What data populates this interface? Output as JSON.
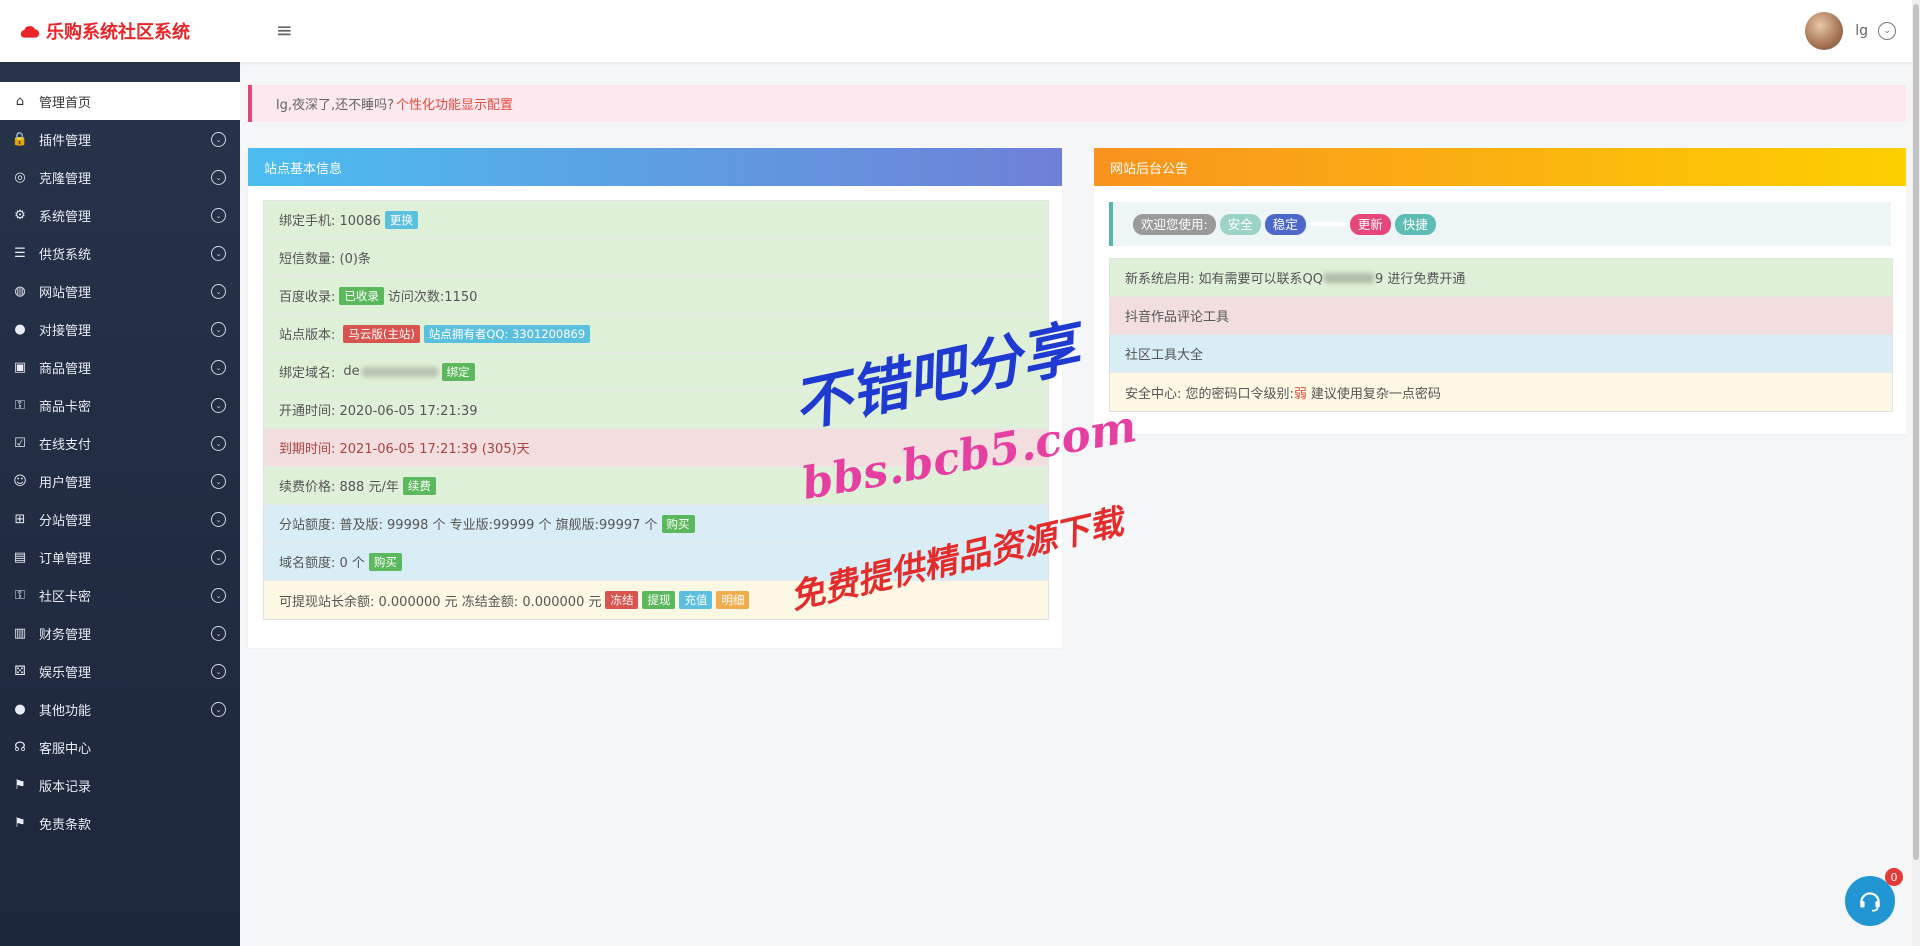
{
  "header": {
    "title": "乐购系统社区系统",
    "username": "lg"
  },
  "sidebar": {
    "items": [
      {
        "label": "管理首页",
        "icon": "home-icon"
      },
      {
        "label": "插件管理",
        "icon": "lock-icon"
      },
      {
        "label": "克隆管理",
        "icon": "clone-icon"
      },
      {
        "label": "系统管理",
        "icon": "gears-icon"
      },
      {
        "label": "供货系统",
        "icon": "list-icon"
      },
      {
        "label": "网站管理",
        "icon": "globe-icon"
      },
      {
        "label": "对接管理",
        "icon": "link-icon"
      },
      {
        "label": "商品管理",
        "icon": "box-icon"
      },
      {
        "label": "商品卡密",
        "icon": "key-icon"
      },
      {
        "label": "在线支付",
        "icon": "calendar-check-icon"
      },
      {
        "label": "用户管理",
        "icon": "users-icon"
      },
      {
        "label": "分站管理",
        "icon": "sitemap-icon"
      },
      {
        "label": "订单管理",
        "icon": "document-icon"
      },
      {
        "label": "社区卡密",
        "icon": "key-icon"
      },
      {
        "label": "财务管理",
        "icon": "bar-chart-icon"
      },
      {
        "label": "娱乐管理",
        "icon": "dice-icon"
      },
      {
        "label": "其他功能",
        "icon": "apple-icon"
      },
      {
        "label": "客服中心",
        "icon": "headset-icon"
      },
      {
        "label": "版本记录",
        "icon": "signpost-icon"
      },
      {
        "label": "免责条款",
        "icon": "signpost-icon"
      }
    ]
  },
  "alert": {
    "text": "lg,夜深了,还不睡吗?",
    "link": "个性化功能显示配置"
  },
  "station_panel": {
    "title": "站点基本信息",
    "phone_label": "绑定手机: 10086",
    "phone_btn": "更换",
    "sms": "短信数量: (0)条",
    "baidu_label": "百度收录:",
    "baidu_badge": "已收录",
    "baidu_visits": "访问次数:1150",
    "version_label": "站点版本:",
    "version_badge": "马云版(主站)",
    "owner_badge": "站点拥有者QQ: 3301200869",
    "domain_label": "绑定域名:",
    "domain_value": "de",
    "domain_btn": "绑定",
    "open_time": "开通时间: 2020-06-05 17:21:39",
    "expire_time": "到期时间: 2021-06-05 17:21:39 (305)天",
    "renew_label": "续费价格: 888 元/年",
    "renew_btn": "续费",
    "substation_quota": "分站额度: 普及版: 99998 个 专业版:99999 个 旗舰版:99997 个",
    "substation_btn": "购买",
    "domain_quota": "域名额度: 0 个",
    "domain_quota_btn": "购买",
    "balance": "可提现站长余额: 0.000000 元 冻结金额: 0.000000 元",
    "balance_btns": [
      "冻结",
      "提现",
      "充值",
      "明细"
    ]
  },
  "notice_panel": {
    "title": "网站后台公告",
    "welcome_pills": [
      "欢迎您使用:",
      "安全",
      "稳定",
      "",
      "更新",
      "快捷"
    ],
    "new_system": "新系统启用: 如有需要可以联系QQ",
    "new_system_suffix": "9 进行免费开通",
    "item2": "抖音作品评论工具",
    "item3": "社区工具大全",
    "security_prefix": "安全中心: 您的密码口令级别:",
    "security_level": "弱",
    "security_suffix": "建议使用复杂一点密码"
  },
  "chat": {
    "badge": "0"
  },
  "watermark": {
    "line1": "不错吧分享",
    "line2": "bbs.bcb5.com",
    "line3": "免费提供精品资源下载"
  }
}
